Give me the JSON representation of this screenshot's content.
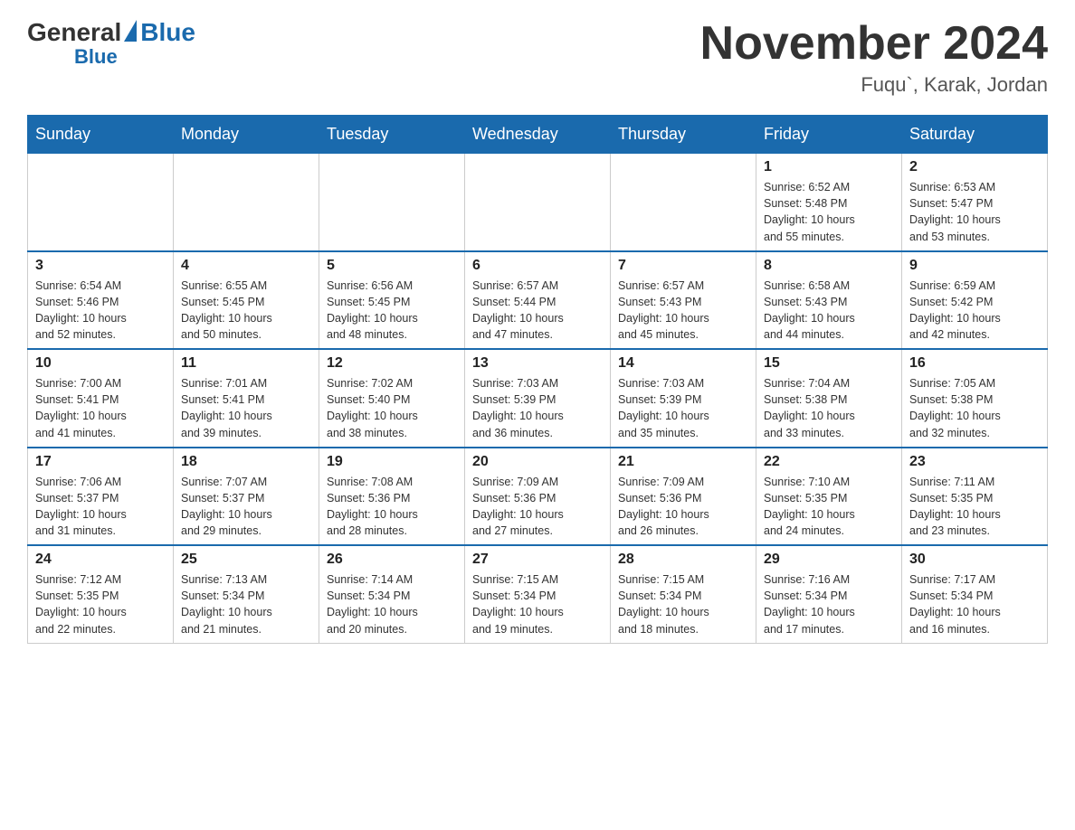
{
  "logo": {
    "general": "General",
    "blue": "Blue"
  },
  "header": {
    "month": "November 2024",
    "location": "Fuqu`, Karak, Jordan"
  },
  "weekdays": [
    "Sunday",
    "Monday",
    "Tuesday",
    "Wednesday",
    "Thursday",
    "Friday",
    "Saturday"
  ],
  "weeks": [
    [
      {
        "day": "",
        "info": ""
      },
      {
        "day": "",
        "info": ""
      },
      {
        "day": "",
        "info": ""
      },
      {
        "day": "",
        "info": ""
      },
      {
        "day": "",
        "info": ""
      },
      {
        "day": "1",
        "info": "Sunrise: 6:52 AM\nSunset: 5:48 PM\nDaylight: 10 hours\nand 55 minutes."
      },
      {
        "day": "2",
        "info": "Sunrise: 6:53 AM\nSunset: 5:47 PM\nDaylight: 10 hours\nand 53 minutes."
      }
    ],
    [
      {
        "day": "3",
        "info": "Sunrise: 6:54 AM\nSunset: 5:46 PM\nDaylight: 10 hours\nand 52 minutes."
      },
      {
        "day": "4",
        "info": "Sunrise: 6:55 AM\nSunset: 5:45 PM\nDaylight: 10 hours\nand 50 minutes."
      },
      {
        "day": "5",
        "info": "Sunrise: 6:56 AM\nSunset: 5:45 PM\nDaylight: 10 hours\nand 48 minutes."
      },
      {
        "day": "6",
        "info": "Sunrise: 6:57 AM\nSunset: 5:44 PM\nDaylight: 10 hours\nand 47 minutes."
      },
      {
        "day": "7",
        "info": "Sunrise: 6:57 AM\nSunset: 5:43 PM\nDaylight: 10 hours\nand 45 minutes."
      },
      {
        "day": "8",
        "info": "Sunrise: 6:58 AM\nSunset: 5:43 PM\nDaylight: 10 hours\nand 44 minutes."
      },
      {
        "day": "9",
        "info": "Sunrise: 6:59 AM\nSunset: 5:42 PM\nDaylight: 10 hours\nand 42 minutes."
      }
    ],
    [
      {
        "day": "10",
        "info": "Sunrise: 7:00 AM\nSunset: 5:41 PM\nDaylight: 10 hours\nand 41 minutes."
      },
      {
        "day": "11",
        "info": "Sunrise: 7:01 AM\nSunset: 5:41 PM\nDaylight: 10 hours\nand 39 minutes."
      },
      {
        "day": "12",
        "info": "Sunrise: 7:02 AM\nSunset: 5:40 PM\nDaylight: 10 hours\nand 38 minutes."
      },
      {
        "day": "13",
        "info": "Sunrise: 7:03 AM\nSunset: 5:39 PM\nDaylight: 10 hours\nand 36 minutes."
      },
      {
        "day": "14",
        "info": "Sunrise: 7:03 AM\nSunset: 5:39 PM\nDaylight: 10 hours\nand 35 minutes."
      },
      {
        "day": "15",
        "info": "Sunrise: 7:04 AM\nSunset: 5:38 PM\nDaylight: 10 hours\nand 33 minutes."
      },
      {
        "day": "16",
        "info": "Sunrise: 7:05 AM\nSunset: 5:38 PM\nDaylight: 10 hours\nand 32 minutes."
      }
    ],
    [
      {
        "day": "17",
        "info": "Sunrise: 7:06 AM\nSunset: 5:37 PM\nDaylight: 10 hours\nand 31 minutes."
      },
      {
        "day": "18",
        "info": "Sunrise: 7:07 AM\nSunset: 5:37 PM\nDaylight: 10 hours\nand 29 minutes."
      },
      {
        "day": "19",
        "info": "Sunrise: 7:08 AM\nSunset: 5:36 PM\nDaylight: 10 hours\nand 28 minutes."
      },
      {
        "day": "20",
        "info": "Sunrise: 7:09 AM\nSunset: 5:36 PM\nDaylight: 10 hours\nand 27 minutes."
      },
      {
        "day": "21",
        "info": "Sunrise: 7:09 AM\nSunset: 5:36 PM\nDaylight: 10 hours\nand 26 minutes."
      },
      {
        "day": "22",
        "info": "Sunrise: 7:10 AM\nSunset: 5:35 PM\nDaylight: 10 hours\nand 24 minutes."
      },
      {
        "day": "23",
        "info": "Sunrise: 7:11 AM\nSunset: 5:35 PM\nDaylight: 10 hours\nand 23 minutes."
      }
    ],
    [
      {
        "day": "24",
        "info": "Sunrise: 7:12 AM\nSunset: 5:35 PM\nDaylight: 10 hours\nand 22 minutes."
      },
      {
        "day": "25",
        "info": "Sunrise: 7:13 AM\nSunset: 5:34 PM\nDaylight: 10 hours\nand 21 minutes."
      },
      {
        "day": "26",
        "info": "Sunrise: 7:14 AM\nSunset: 5:34 PM\nDaylight: 10 hours\nand 20 minutes."
      },
      {
        "day": "27",
        "info": "Sunrise: 7:15 AM\nSunset: 5:34 PM\nDaylight: 10 hours\nand 19 minutes."
      },
      {
        "day": "28",
        "info": "Sunrise: 7:15 AM\nSunset: 5:34 PM\nDaylight: 10 hours\nand 18 minutes."
      },
      {
        "day": "29",
        "info": "Sunrise: 7:16 AM\nSunset: 5:34 PM\nDaylight: 10 hours\nand 17 minutes."
      },
      {
        "day": "30",
        "info": "Sunrise: 7:17 AM\nSunset: 5:34 PM\nDaylight: 10 hours\nand 16 minutes."
      }
    ]
  ]
}
